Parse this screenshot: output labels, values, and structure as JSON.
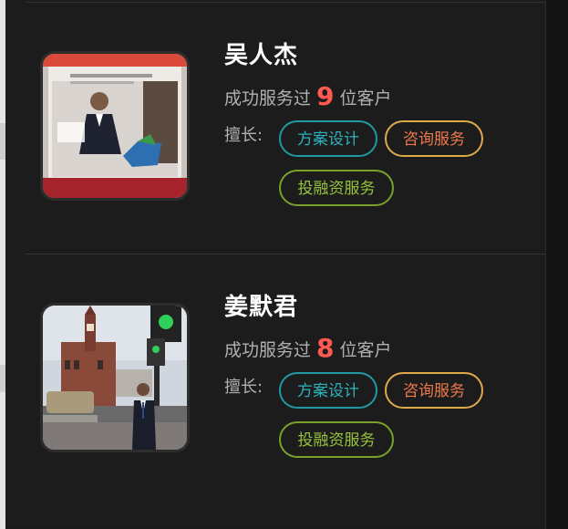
{
  "consultants": [
    {
      "name": "吴人杰",
      "served_prefix": "成功服务过",
      "served_count": "9",
      "served_suffix": "位客户",
      "skills_label": "擅长:",
      "tags": [
        "方案设计",
        "咨询服务",
        "投融资服务"
      ]
    },
    {
      "name": "姜默君",
      "served_prefix": "成功服务过",
      "served_count": "8",
      "served_suffix": "位客户",
      "skills_label": "擅长:",
      "tags": [
        "方案设计",
        "咨询服务",
        "投融资服务"
      ]
    }
  ],
  "colors": {
    "count": "#ff5a52",
    "tag_teal": "#1f9aa3",
    "tag_orange": "#e0a94a",
    "tag_green": "#7aa22a",
    "background": "#1c1c1c"
  },
  "icons": {
    "avatar_1": "photo-man-with-logo",
    "avatar_2": "photo-man-street-clocktower"
  }
}
